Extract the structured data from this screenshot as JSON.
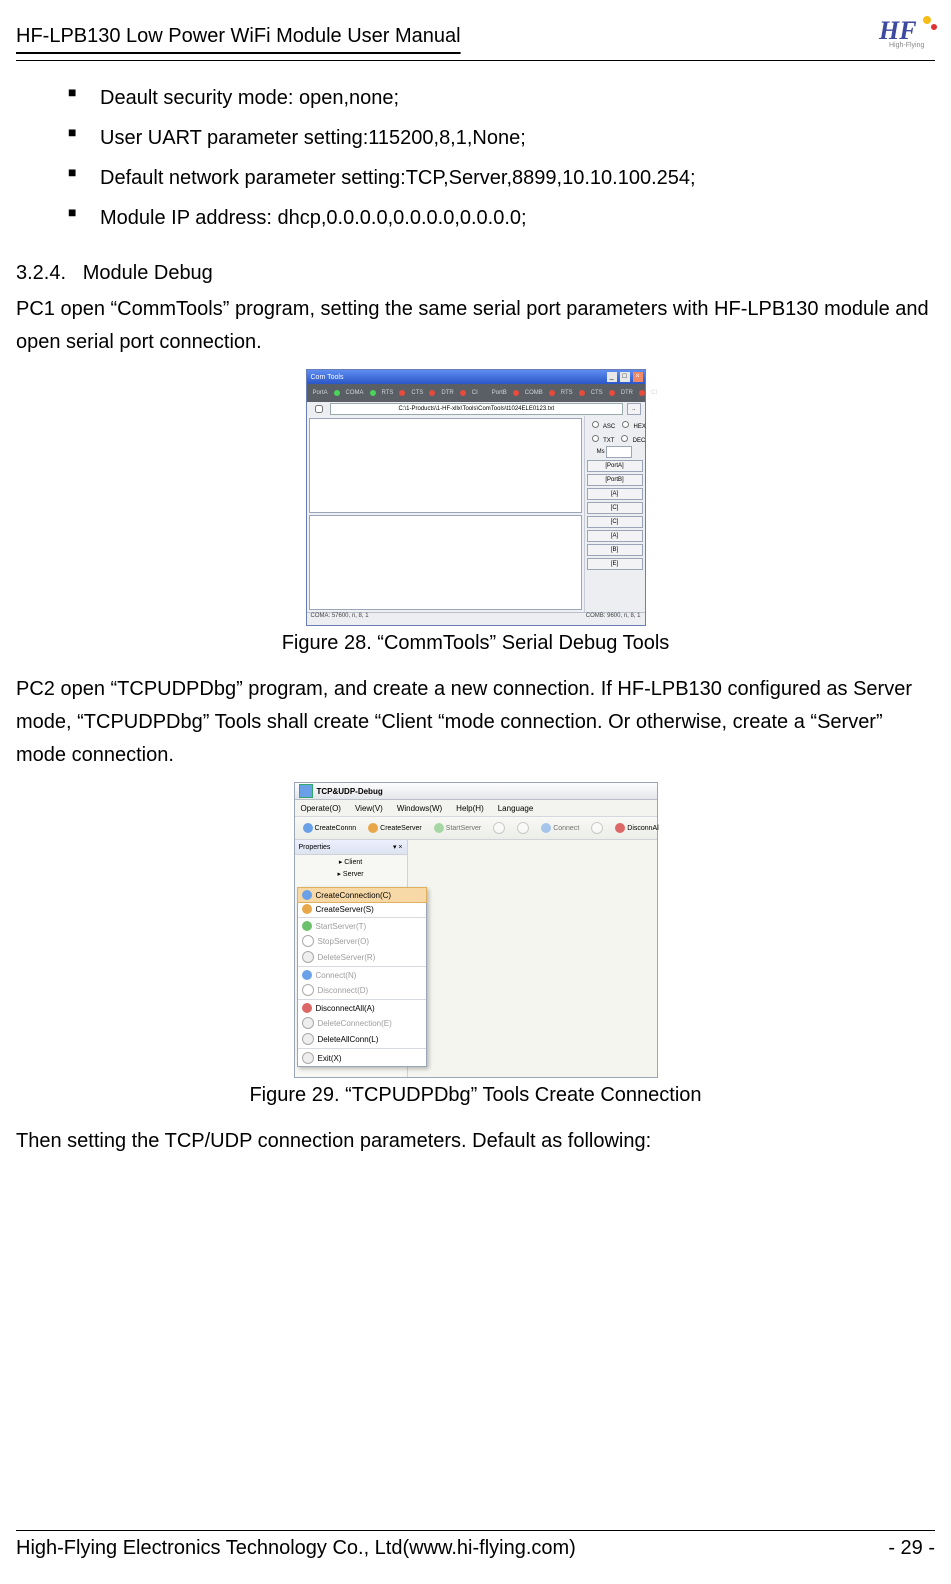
{
  "header": {
    "title": "HF-LPB130 Low Power WiFi Module User Manual",
    "logo_text": "HF",
    "logo_sub": "High-Flying"
  },
  "bullets": [
    "Deault security mode: open,none;",
    "User UART parameter setting:115200,8,1,None;",
    "Default network parameter setting:TCP,Server,8899,10.10.100.254;",
    "Module IP address: dhcp,0.0.0.0,0.0.0.0,0.0.0.0;"
  ],
  "section": {
    "number": "3.2.4.",
    "title": "Module Debug"
  },
  "para1": "PC1 open “CommTools” program, setting the same serial port parameters with HF-LPB130 module and open serial port connection.",
  "fig28": {
    "caption": "Figure 28.   “CommTools” Serial Debug Tools",
    "window_title": "Com Tools",
    "ports": {
      "port_a_label": "PortA",
      "port_b_label": "PortB",
      "led_labels": [
        "COMA",
        "RTS",
        "CTS",
        "DTR",
        "CI",
        "COMB",
        "RTS",
        "CTS",
        "DTR",
        "CI"
      ]
    },
    "path": "C:\\1-Products\\1-HF-xllx\\Tools\\ComTools\\t1024ELE0123.txt",
    "path_btn": "..",
    "right_panel": {
      "options": [
        "ASC",
        "HEX",
        "TXT",
        "DEC"
      ],
      "buttons": [
        "[PortA]",
        "[PortB]",
        "[A]",
        "[C]",
        "[C]",
        "[A]",
        "[B]",
        "[E]"
      ],
      "ms": "Ms"
    },
    "status_left": "COMA: 57600, n, 8, 1",
    "status_right": "COMB: 9600, n, 8, 1"
  },
  "para2": "PC2 open “TCPUDPDbg” program, and create a new connection. If HF-LPB130 configured as Server mode, “TCPUDPDbg” Tools shall create “Client “mode connection. Or otherwise, create a “Server” mode connection.",
  "fig29": {
    "caption": "Figure 29.    “TCPUDPDbg” Tools Create Connection",
    "window_title": "TCP&UDP-Debug",
    "menus": [
      "Operate(O)",
      "View(V)",
      "Windows(W)",
      "Help(H)",
      "Language"
    ],
    "toolbar": [
      "CreateConnn",
      "CreateServer",
      "StartServer",
      "Connect",
      "DisconnAl"
    ],
    "properties_title": "Properties",
    "tree": [
      "Client",
      "Server"
    ],
    "context_menu": [
      {
        "label": "CreateConnection(C)",
        "icon": "blue",
        "state": "hl"
      },
      {
        "label": "CreateServer(S)",
        "icon": "orange",
        "state": ""
      },
      {
        "label": "StartServer(T)",
        "icon": "green",
        "state": "sep dis"
      },
      {
        "label": "StopServer(O)",
        "icon": "x",
        "state": "dis"
      },
      {
        "label": "DeleteServer(R)",
        "icon": "del",
        "state": "dis"
      },
      {
        "label": "Connect(N)",
        "icon": "blue",
        "state": "sep dis"
      },
      {
        "label": "Disconnect(D)",
        "icon": "x",
        "state": "dis"
      },
      {
        "label": "DisconnectAll(A)",
        "icon": "red",
        "state": "sep"
      },
      {
        "label": "DeleteConnection(E)",
        "icon": "del",
        "state": "dis"
      },
      {
        "label": "DeleteAllConn(L)",
        "icon": "del",
        "state": ""
      },
      {
        "label": "Exit(X)",
        "icon": "exit",
        "state": "sep"
      }
    ]
  },
  "para3": "Then setting the TCP/UDP connection parameters. Default as following:",
  "footer": {
    "left": "High-Flying Electronics Technology Co., Ltd(www.hi-flying.com)",
    "right": "- 29 -"
  }
}
